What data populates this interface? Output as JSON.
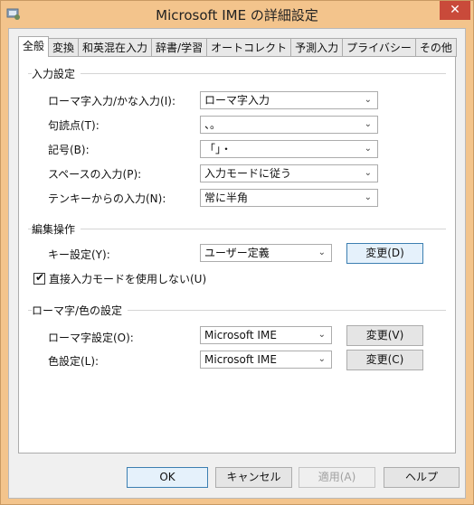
{
  "window": {
    "title": "Microsoft IME の詳細設定",
    "close_label": "✕"
  },
  "tabs": [
    "全般",
    "変換",
    "和英混在入力",
    "辞書/学習",
    "オートコレクト",
    "予測入力",
    "プライバシー",
    "その他"
  ],
  "input_settings": {
    "group_title": "入力設定",
    "rows": [
      {
        "label": "ローマ字入力/かな入力(I):",
        "value": "ローマ字入力"
      },
      {
        "label": "句読点(T):",
        "value": "、。"
      },
      {
        "label": "記号(B):",
        "value": "「」・"
      },
      {
        "label": "スペースの入力(P):",
        "value": "入力モードに従う"
      },
      {
        "label": "テンキーからの入力(N):",
        "value": "常に半角"
      }
    ]
  },
  "edit_ops": {
    "group_title": "編集操作",
    "key_label": "キー設定(Y):",
    "key_value": "ユーザー定義",
    "change_label": "変更(D)",
    "checkbox_label": "直接入力モードを使用しない(U)",
    "checkbox_checked": true
  },
  "romaji_color": {
    "group_title": "ローマ字/色の設定",
    "romaji_label": "ローマ字設定(O):",
    "romaji_value": "Microsoft IME",
    "romaji_change": "変更(V)",
    "color_label": "色設定(L):",
    "color_value": "Microsoft IME",
    "color_change": "変更(C)"
  },
  "footer": {
    "ok": "OK",
    "cancel": "キャンセル",
    "apply": "適用(A)",
    "help": "ヘルプ"
  },
  "colors": {
    "titlebar": "#f3c48c",
    "close": "#c94a3a",
    "focus_border": "#3c7fb1"
  }
}
